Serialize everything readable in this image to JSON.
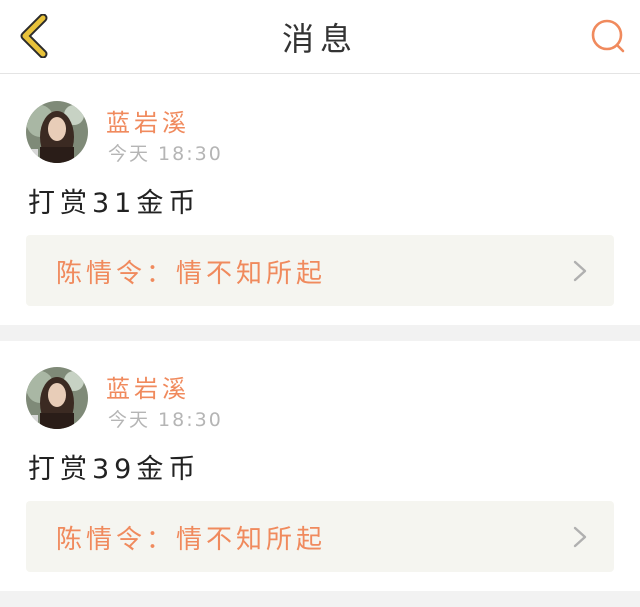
{
  "header": {
    "title": "消息",
    "back_icon": "chevron-left-icon",
    "search_icon": "search-icon"
  },
  "colors": {
    "accent": "#f08a5d",
    "back_icon": "#e8c23a",
    "text": "#222222",
    "muted": "#b5b5b5",
    "ref_bg": "#f5f5f0"
  },
  "messages": [
    {
      "username": "蓝岩溪",
      "time": "今天 18:30",
      "content": "打赏31金币",
      "reference": "陈情令：情不知所起"
    },
    {
      "username": "蓝岩溪",
      "time": "今天 18:30",
      "content": "打赏39金币",
      "reference": "陈情令：情不知所起"
    }
  ]
}
